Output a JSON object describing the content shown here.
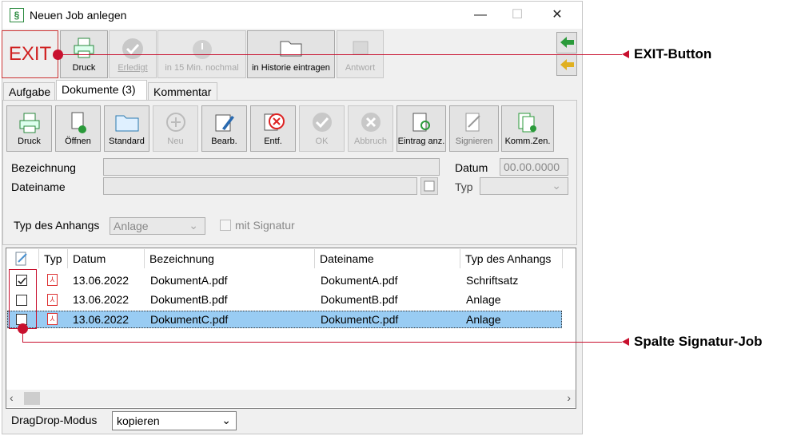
{
  "window": {
    "title": "Neuen Job anlegen"
  },
  "toolbar": {
    "exit": "EXIT",
    "druck": "Druck",
    "erledigt": "Erledigt",
    "in15": "in 15 Min. nochmal",
    "historie": "in Historie eintragen",
    "antwort": "Antwort"
  },
  "tabs": [
    "Aufgabe",
    "Dokumente (3)",
    "Kommentar"
  ],
  "doc_buttons": [
    "Druck",
    "Öffnen",
    "Standard",
    "Neu",
    "Bearb.",
    "Entf.",
    "OK",
    "Abbruch",
    "Eintrag anz.",
    "Signieren",
    "Komm.Zen."
  ],
  "form": {
    "bezeichnung": "Bezeichnung",
    "dateiname": "Dateiname",
    "datum_label": "Datum",
    "datum_value": "00.00.0000",
    "typ": "Typ",
    "anhang_label": "Typ des Anhangs",
    "anhang_value": "Anlage",
    "signatur": "mit Signatur"
  },
  "table": {
    "columns": [
      "Typ",
      "Datum",
      "Bezeichnung",
      "Dateiname",
      "Typ des Anhangs"
    ],
    "rows": [
      {
        "datum": "13.06.2022",
        "bez": "DokumentA.pdf",
        "datei": "DokumentA.pdf",
        "typ": "Schriftsatz",
        "checked": true
      },
      {
        "datum": "13.06.2022",
        "bez": "DokumentB.pdf",
        "datei": "DokumentB.pdf",
        "typ": "Anlage",
        "checked": false
      },
      {
        "datum": "13.06.2022",
        "bez": "DokumentC.pdf",
        "datei": "DokumentC.pdf",
        "typ": "Anlage",
        "checked": false
      }
    ]
  },
  "footer": {
    "label": "DragDrop-Modus",
    "value": "kopieren"
  },
  "annotations": {
    "exit": "EXIT-Button",
    "signatur": "Spalte Signatur-Job"
  }
}
